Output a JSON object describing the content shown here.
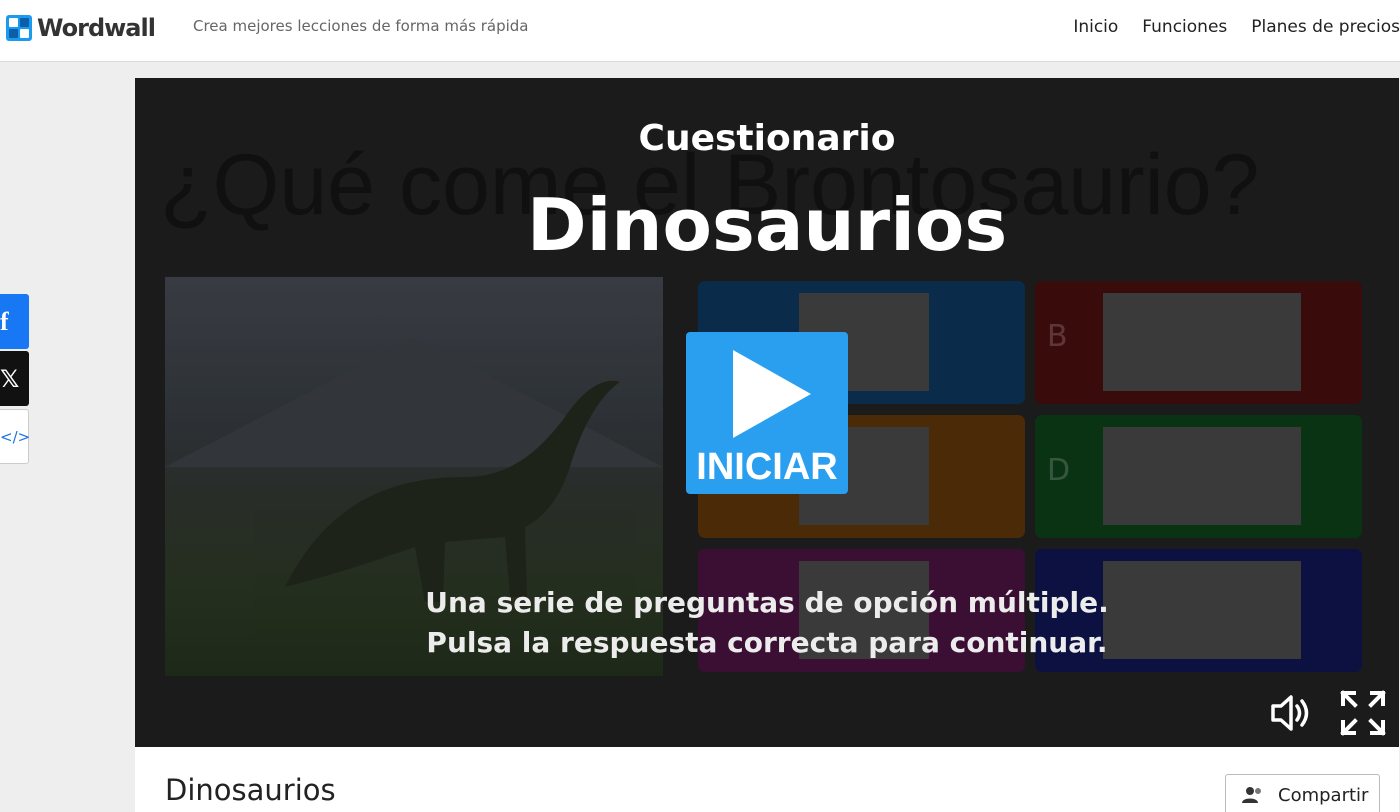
{
  "brand": {
    "name": "Wordwall",
    "tagline": "Crea mejores lecciones de forma más rápida"
  },
  "nav": {
    "items": [
      "Inicio",
      "Funciones",
      "Planes de precios"
    ]
  },
  "social": {
    "facebook": "f",
    "x": "𝕏",
    "embed": "</>"
  },
  "activity": {
    "background_question": "¿Qué come el Brontosaurio?",
    "template": "Cuestionario",
    "title": "Dinosaurios",
    "start_label": "INICIAR",
    "description_line1": "Una serie de preguntas de opción múltiple.",
    "description_line2": "Pulsa la respuesta correcta para continuar.",
    "answer_letters": [
      "",
      "B",
      "",
      "D",
      "",
      ""
    ]
  },
  "info": {
    "title": "Dinosaurios",
    "share_label": "Compartir"
  }
}
